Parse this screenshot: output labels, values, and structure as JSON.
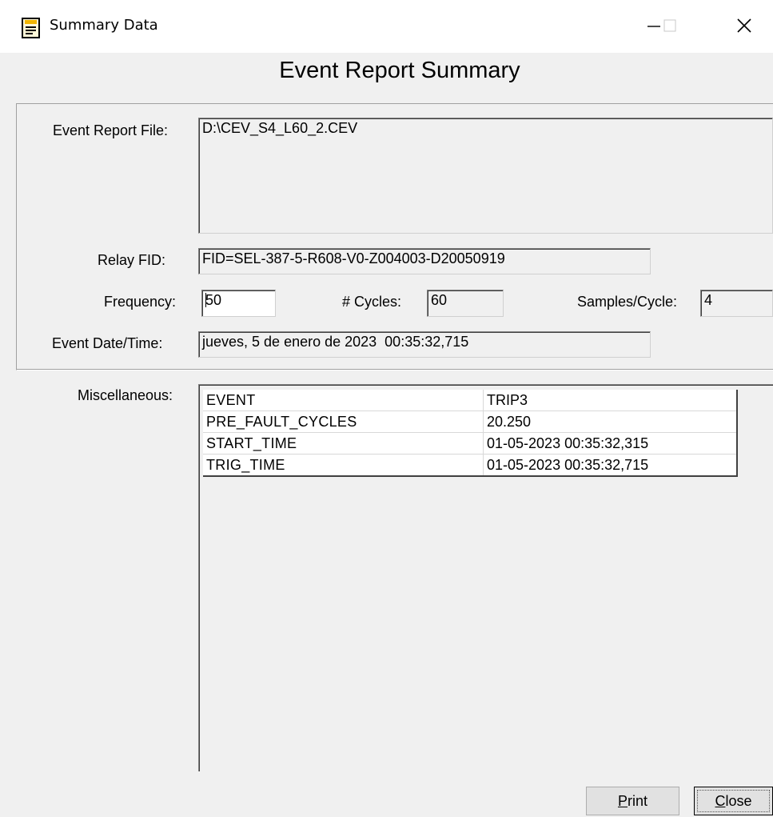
{
  "window": {
    "title": "Summary Data",
    "icon": "document-list-icon",
    "controls": {
      "minimize": "minimize-icon",
      "maximize": "maximize-icon",
      "close": "close-icon"
    }
  },
  "heading": "Event Report Summary",
  "fields": {
    "event_report_file": {
      "label": "Event Report File:",
      "value": "D:\\CEV_S4_L60_2.CEV"
    },
    "relay_fid": {
      "label": "Relay FID:",
      "value": "FID=SEL-387-5-R608-V0-Z004003-D20050919"
    },
    "frequency": {
      "label": "Frequency:",
      "value": "50"
    },
    "cycles": {
      "label": "# Cycles:",
      "value": "60"
    },
    "samples_per_cycle": {
      "label": "Samples/Cycle:",
      "value": "4"
    },
    "event_datetime": {
      "label": "Event Date/Time:",
      "value": "jueves, 5 de enero de 2023  00:35:32,715"
    }
  },
  "miscellaneous": {
    "label": "Miscellaneous:",
    "rows": [
      {
        "key": "EVENT",
        "value": "TRIP3"
      },
      {
        "key": "PRE_FAULT_CYCLES",
        "value": "20.250"
      },
      {
        "key": "START_TIME",
        "value": "01-05-2023 00:35:32,315"
      },
      {
        "key": "TRIG_TIME",
        "value": "01-05-2023 00:35:32,715"
      }
    ]
  },
  "buttons": {
    "print": {
      "mnemonic": "P",
      "rest": "rint"
    },
    "close": {
      "mnemonic": "C",
      "rest": "lose"
    }
  },
  "colors": {
    "window_bg": "#f0f0f0",
    "titlebar_bg": "#ffffff",
    "icon_accent": "#f0b400"
  }
}
